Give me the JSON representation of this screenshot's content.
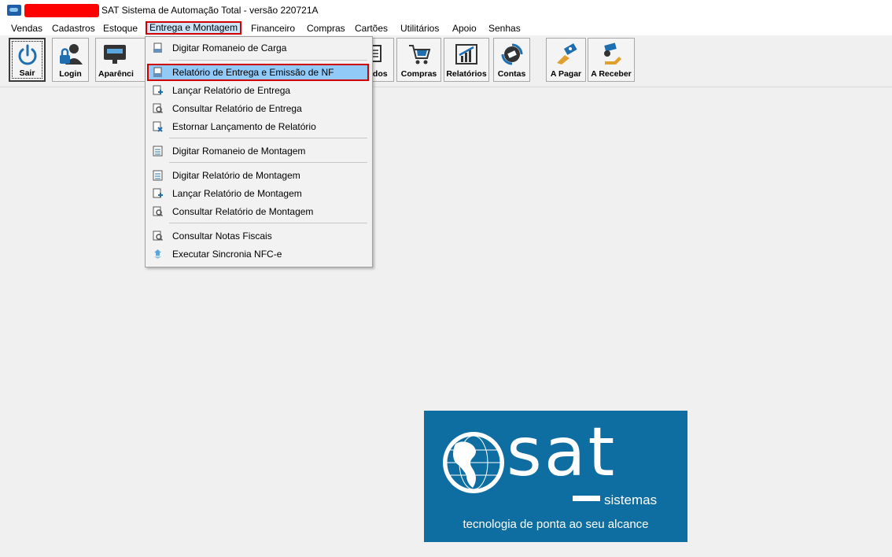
{
  "window": {
    "title": "SAT Sistema de Automação Total - versão 220721A"
  },
  "menubar": {
    "items": [
      "Vendas",
      "Cadastros",
      "Estoque",
      "Entrega e Montagem",
      "Financeiro",
      "Compras",
      "Cartões",
      "Utilitários",
      "Apoio",
      "Senhas"
    ],
    "open_item": "Entrega e Montagem"
  },
  "toolbar": {
    "buttons": [
      {
        "label": "Sair",
        "icon": "power-icon"
      },
      {
        "label": "Login",
        "icon": "user-lock-icon"
      },
      {
        "label": "Aparênci",
        "icon": "monitor-icon"
      },
      {
        "label": "idos",
        "icon": "document-icon"
      },
      {
        "label": "Compras",
        "icon": "cart-icon"
      },
      {
        "label": "Relatórios",
        "icon": "chart-icon"
      },
      {
        "label": "Contas",
        "icon": "coin-icon"
      },
      {
        "label": "A Pagar",
        "icon": "pay-icon"
      },
      {
        "label": "A Receber",
        "icon": "receive-icon"
      }
    ]
  },
  "dropdown": {
    "items": [
      {
        "label": "Digitar Romaneio de Carga"
      },
      {
        "label": "Relatório de Entrega e Emissão de NF",
        "selected": true
      },
      {
        "label": "Lançar Relatório de Entrega"
      },
      {
        "label": "Consultar Relatório de Entrega"
      },
      {
        "label": "Estornar Lançamento de Relatório"
      },
      {
        "label": "Digitar Romaneio de Montagem"
      },
      {
        "label": "Digitar Relatório de Montagem"
      },
      {
        "label": "Lançar Relatório de Montagem"
      },
      {
        "label": "Consultar Relatório de Montagem"
      },
      {
        "label": "Consultar Notas Fiscais"
      },
      {
        "label": "Executar Sincronia NFC-e"
      }
    ]
  },
  "logo": {
    "word": "sat",
    "sub": "sistemas",
    "tagline": "tecnologia de ponta ao seu alcance"
  },
  "colors": {
    "highlight_border": "#d00000",
    "selected_bg": "#91c9f7",
    "logo_bg": "#0f6ea1"
  }
}
